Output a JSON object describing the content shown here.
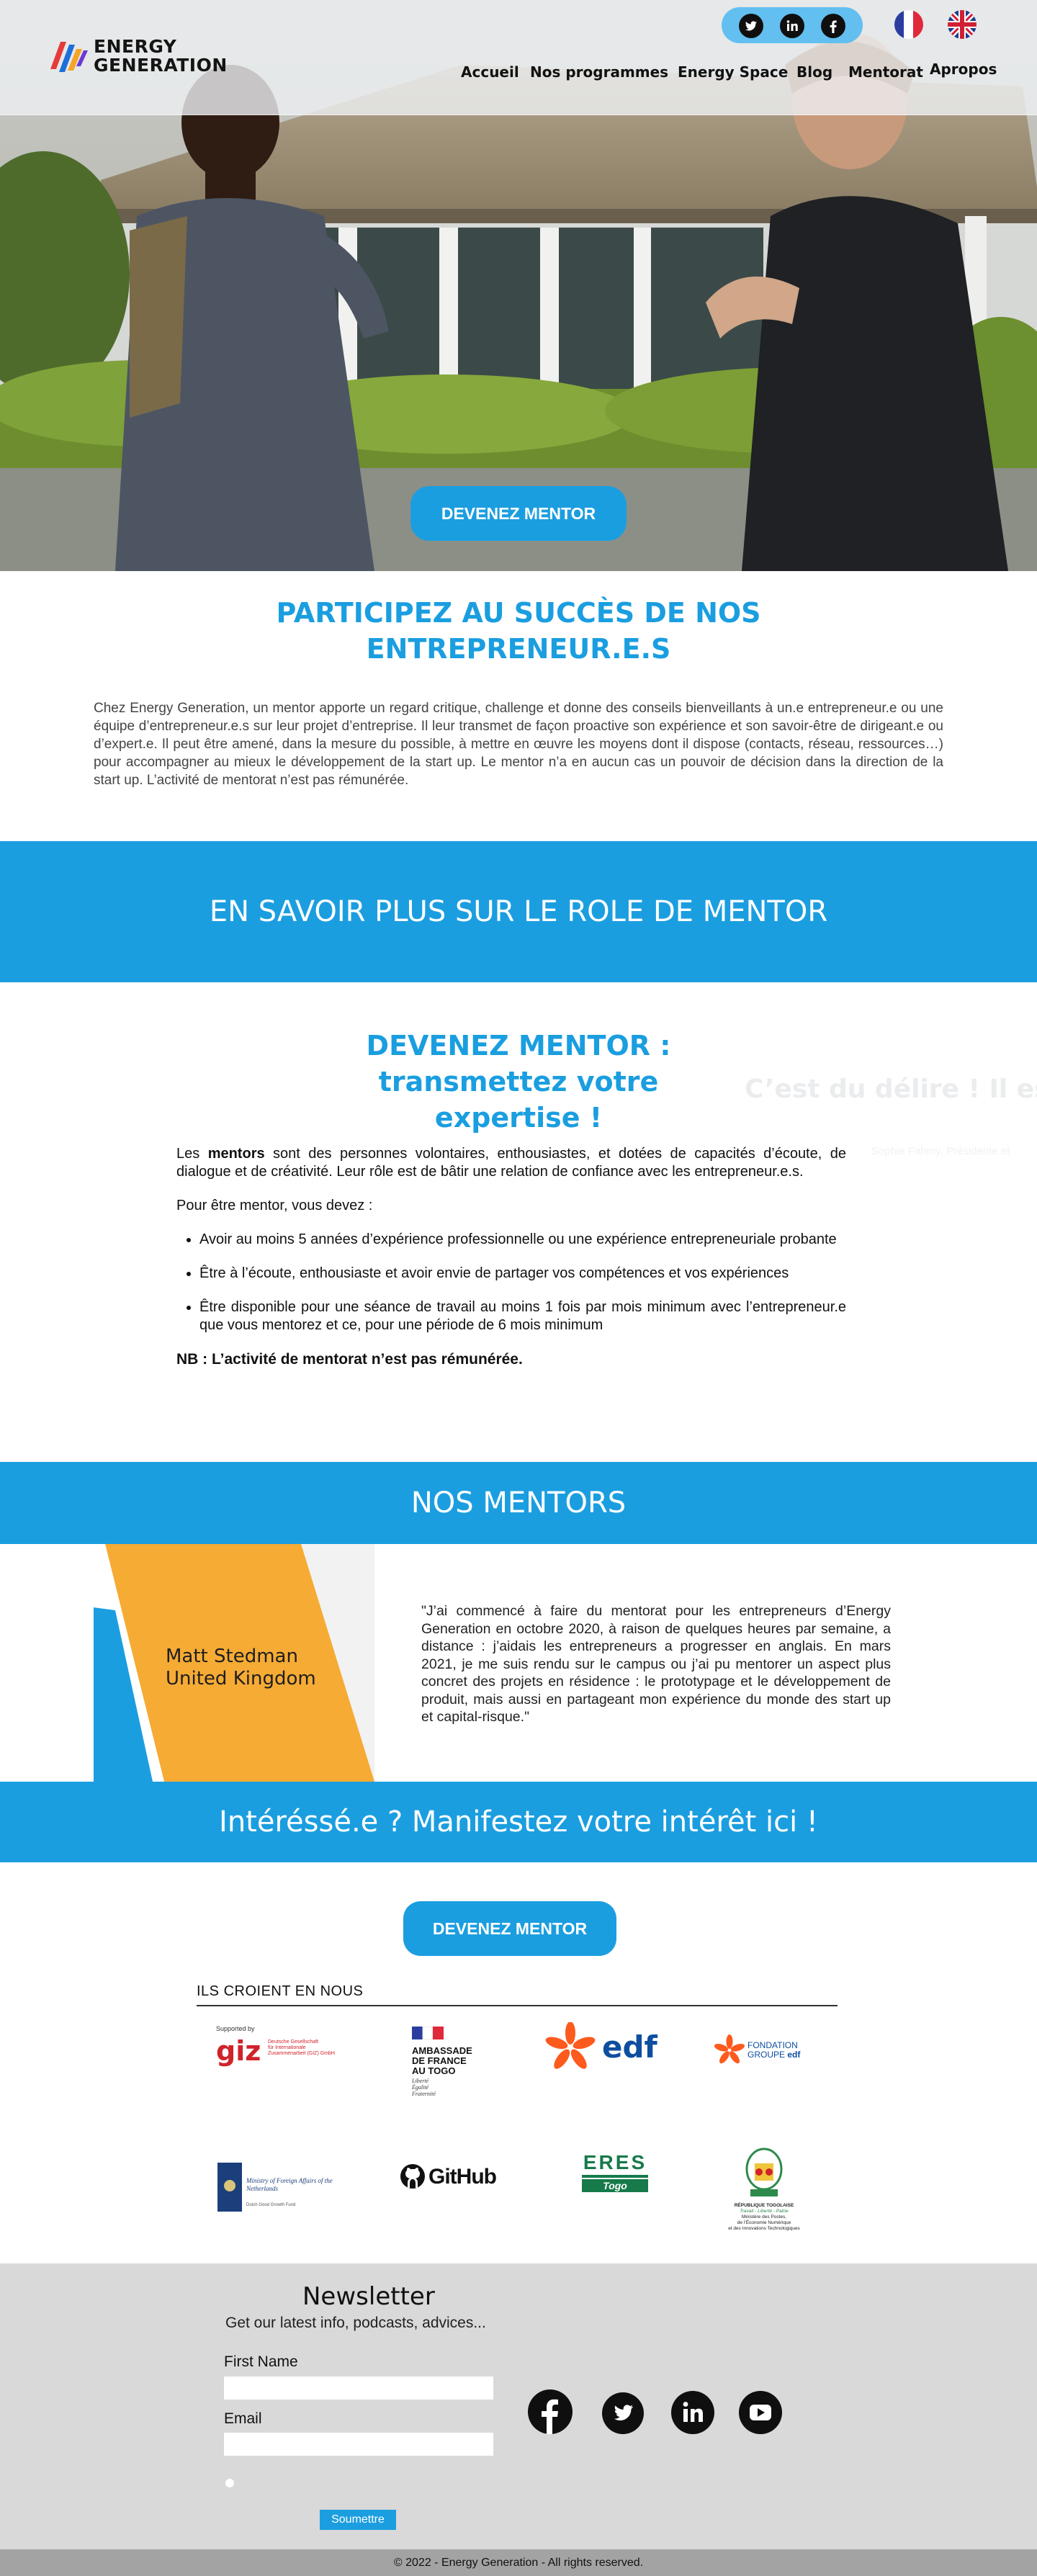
{
  "brand": {
    "line1": "ENERGY",
    "line2": "GENERATION"
  },
  "nav": {
    "items": [
      "Accueil",
      "Nos programmes",
      "Energy Space",
      "Blog",
      "Mentorat",
      "Apropos"
    ]
  },
  "header_social": [
    "twitter-icon",
    "linkedin-icon",
    "facebook-icon"
  ],
  "languages": [
    "Français",
    "English"
  ],
  "hero": {
    "cta": "DEVENEZ MENTOR"
  },
  "intro": {
    "title": "PARTICIPEZ AU SUCCÈS DE NOS ENTREPRENEUR.E.S",
    "text": "Chez Energy Generation, un mentor apporte un regard critique, challenge et donne des conseils bienveillants à un.e entrepreneur.e ou une équipe d’entrepreneur.e.s sur leur projet d’entreprise. Il leur transmet de façon proactive son expérience et son savoir-être de dirigeant.e ou d’expert.e. Il peut être amené, dans la mesure du possible, à mettre en œuvre les moyens dont il dispose (contacts, réseau, ressources…) pour accompagner au mieux le développement de la start up. Le mentor n’a en aucun cas un pouvoir de décision dans la direction de la start up. L’activité de mentorat n’est pas rémunérée."
  },
  "band_role": "EN SAVOIR PLUS SUR LE ROLE DE MENTOR",
  "mentor": {
    "title_line1": "DEVENEZ MENTOR :",
    "title_line2": "transmettez votre expertise !",
    "ghost_heading": "C’est du délire ! Il est t",
    "ghost_sub": "Sophie Fahmy, Présidente et",
    "para_prefix": "Les ",
    "para_bold": "mentors",
    "para_rest": " sont des personnes volontaires, enthousiastes, et dotées de capacités d’écoute, de dialogue et de créativité. Leur rôle est de bâtir une relation de confiance avec les entrepreneur.e.s.",
    "must": "Pour être mentor, vous devez :",
    "requirements": [
      "Avoir au moins 5 années d’expérience professionnelle ou une expérience entrepreneuriale probante",
      "Être à l’écoute, enthousiaste et avoir envie de partager vos compétences et vos expériences",
      "Être disponible pour une séance de travail au moins 1 fois par mois minimum avec l’entrepreneur.e que vous mentorez et ce, pour une période de 6 mois minimum"
    ],
    "nb": "NB : L’activité de mentorat n’est pas rémunérée."
  },
  "band_mentors": "NOS MENTORS",
  "testimonial": {
    "name": "Matt Stedman",
    "country": "United Kingdom",
    "quote": "\"J’ai commencé à faire du mentorat pour les entrepreneurs d’Energy Generation en octobre 2020, à raison de quelques heures par semaine, a distance : j’aidais les entrepreneurs a progresser en anglais. En mars 2021, je me suis rendu sur le campus ou j’ai pu mentorer un aspect plus concret des projets en résidence : le prototypage et le développement de produit, mais aussi en partageant mon expérience du monde des start up et capital-risque.\""
  },
  "band_interest": "Intéréssé.e ? Manifestez votre intérêt ici !",
  "cta2": "DEVENEZ MENTOR",
  "partners": {
    "heading": "ILS CROIENT EN NOUS",
    "giz": {
      "supported": "Supported by",
      "name": "giz",
      "line1": "Deutsche Gesellschaft",
      "line2": "für Internationale",
      "line3": "Zusammenarbeit (GIZ) GmbH"
    },
    "ambassade": {
      "l1": "AMBASSADE",
      "l2": "DE FRANCE",
      "l3": "AU TOGO",
      "motto1": "Liberté",
      "motto2": "Égalité",
      "motto3": "Fraternité"
    },
    "edf": "edf",
    "fondation": {
      "l1": "FONDATION",
      "l2": "GROUPE",
      "l3": "edf"
    },
    "netherlands": {
      "l1": "Ministry of Foreign Affairs of the",
      "l2": "Netherlands",
      "l3": "Dutch Good Growth Fund"
    },
    "github": "GitHub",
    "eres": {
      "top": "ERES",
      "bottom": "Togo"
    },
    "togo": {
      "l1": "RÉPUBLIQUE TOGOLAISE",
      "l2": "Travail - Liberté - Patrie",
      "l3": "Ministère des Postes,",
      "l4": "de l’Économie Numérique",
      "l5": "et des Innovations Technologiques"
    }
  },
  "newsletter": {
    "title": "Newsletter",
    "subtitle": "Get our latest info, podcasts, advices...",
    "first_name_label": "First Name",
    "email_label": "Email",
    "submit": "Soumettre"
  },
  "footer_social": [
    "facebook-icon",
    "twitter-icon",
    "linkedin-icon",
    "youtube-icon"
  ],
  "copyright": "© 2022 - Energy Generation - All rights reserved."
}
